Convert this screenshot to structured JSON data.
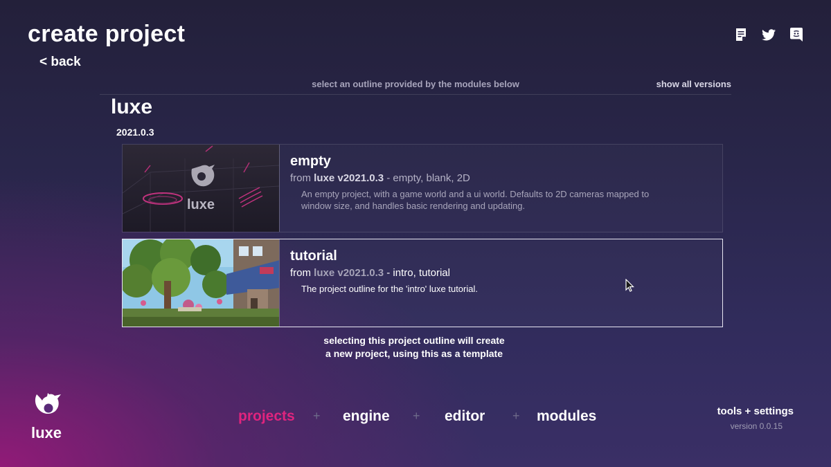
{
  "header": {
    "title": "create project",
    "back_label": "< back"
  },
  "top_icons": [
    "document-icon",
    "twitter-icon",
    "discord-icon"
  ],
  "picker": {
    "hint": "select an outline provided by the modules below",
    "show_all_label": "show all versions",
    "module": "luxe",
    "version": "2021.0.3"
  },
  "outlines": [
    {
      "name": "empty",
      "from_prefix": "from",
      "from_module": "luxe v2021.0.3",
      "from_tags": "- empty, blank, 2D",
      "description": "An empty project, with a game world and a ui world. Defaults to 2D cameras mapped to window size, and handles basic rendering and updating.",
      "thumb_label": "luxe"
    },
    {
      "name": "tutorial",
      "from_prefix": "from",
      "from_module": "luxe v2021.0.3",
      "from_tags": "- intro, tutorial",
      "description": "The project outline for the 'intro' luxe tutorial.",
      "selected": true
    }
  ],
  "selection_note": {
    "line1": "selecting this project outline will create",
    "line2": "a new project, using this as a template"
  },
  "footer": {
    "brand": "luxe",
    "nav": [
      "projects",
      "engine",
      "editor",
      "modules"
    ],
    "nav_separator": "+",
    "active_nav": "projects",
    "tools_label": "tools + settings",
    "version": "version 0.0.15"
  },
  "colors": {
    "accent": "#e0247e",
    "background": "#29264a"
  }
}
